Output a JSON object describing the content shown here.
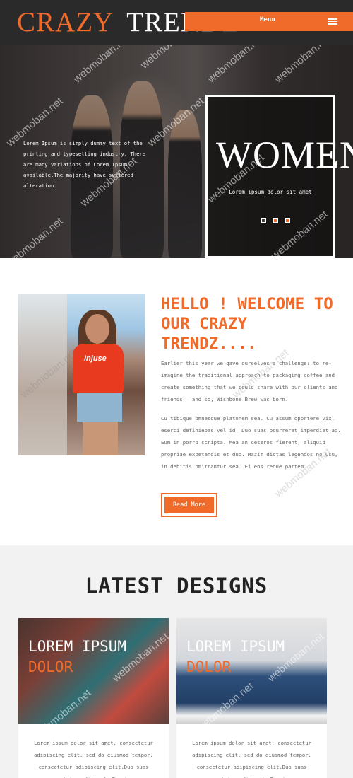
{
  "header": {
    "logo_word1": "CRAZY",
    "logo_word2": "TRENDZ",
    "menu_label": "Menu",
    "accent_color": "#f06b2a"
  },
  "hero": {
    "intro_text": "Lorem Ipsum is simply dummy text of the printing and typesetting industry. There are many variations of Lorem Ipsum available.The majority have suffered alteration.",
    "slide_title": "WOMEN",
    "slide_subtitle": "Lorem ipsum dolor sit amet"
  },
  "watermark": "webmoban.net",
  "welcome": {
    "title": "HELLO ! WELCOME TO OUR CRAZY TRENDZ....",
    "paragraph1": "Earlier this year we gave ourselves a challenge: to re-imagine the traditional approach to packaging coffee and create something that we could share with our clients and friends – and so, Wishbone Brew was born.",
    "paragraph2": "Cu tibique omnesque platonem sea. Cu assum oportere vix, eserci definiebas vel id. Duo suas ocurreret imperdiet ad. Eum in porro scripta. Mea an ceteros fierent, aliquid propriae expetendis et duo. Mazim dictas legendos no usu, in debitis omittantur sea. Ei eos reque partem.",
    "tee_text": "Injuse",
    "read_more": "Read More"
  },
  "latest": {
    "title": "LATEST DESIGNS",
    "cards": [
      {
        "line1": "LOREM IPSUM",
        "line2": "DOLOR",
        "text": "Lorem ipsum dolor sit amet, consectetur adipiscing elit, sed do eiusmod tempor, consectetur adipiscing elit.Duo suas ocurreret imperdiet ad. Eum in porro"
      },
      {
        "line1": "LOREM IPSUM",
        "line2": "DOLOR",
        "text": "Lorem ipsum dolor sit amet, consectetur adipiscing elit, sed do eiusmod tempor, consectetur adipiscing elit.Duo suas ocurreret imperdiet ad. Eum in porro"
      }
    ]
  }
}
